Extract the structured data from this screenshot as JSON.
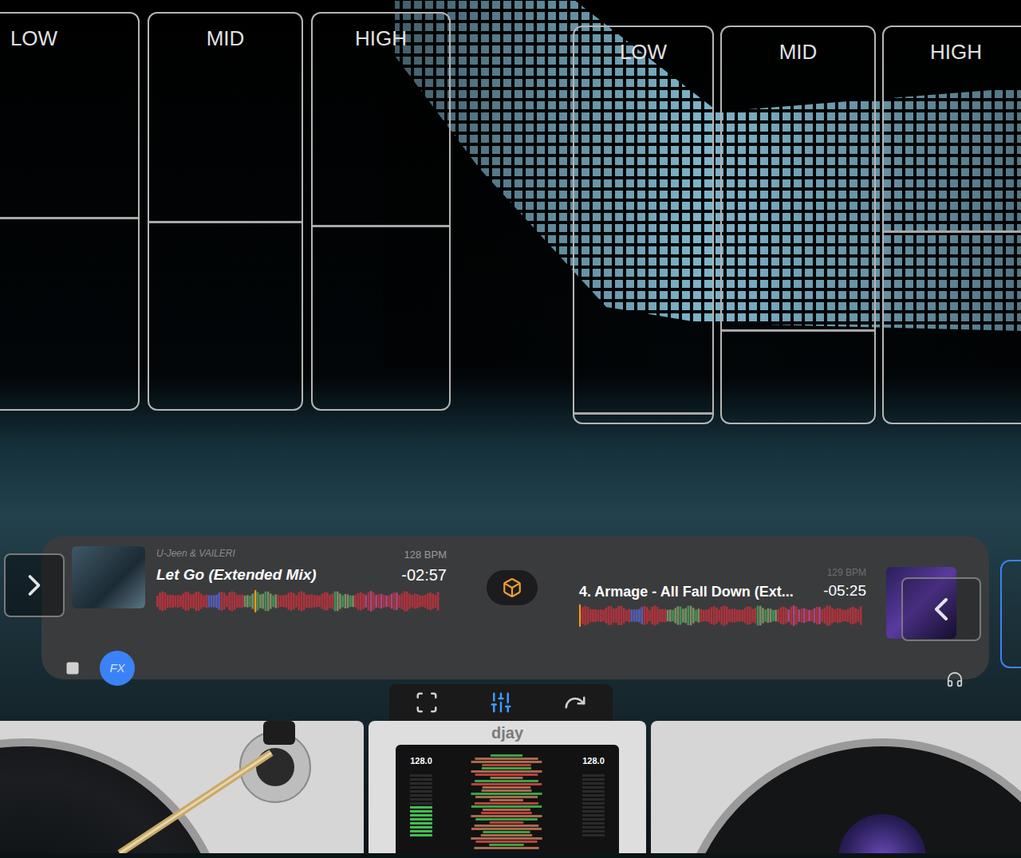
{
  "eq": [
    {
      "deck": "left",
      "bands": [
        {
          "label": "LOW",
          "level": 0.48
        },
        {
          "label": "MID",
          "level": 0.47
        },
        {
          "label": "HIGH",
          "level": 0.46
        }
      ]
    },
    {
      "deck": "right",
      "bands": [
        {
          "label": "LOW",
          "level": 0.02
        },
        {
          "label": "MID",
          "level": 0.23
        },
        {
          "label": "HIGH",
          "level": 0.48
        }
      ]
    }
  ],
  "decks": [
    {
      "side": "left",
      "artist": "U-Jeen & VAILERI",
      "title": "Let Go (Extended Mix)",
      "bpm": "128 BPM",
      "remaining": "-02:57",
      "progress": 0.35
    },
    {
      "side": "right",
      "title": "4. Armage - All Fall Down (Ext...",
      "bpm": "129 BPM",
      "remaining": "-05:25",
      "progress": 0.0
    }
  ],
  "fx_button": {
    "label": "FX",
    "on": true
  },
  "toolbar": [
    {
      "kind": "layout",
      "selected": false
    },
    {
      "kind": "mixer",
      "selected": true
    },
    {
      "kind": "automix",
      "selected": false
    }
  ],
  "mixer": {
    "logo": "djay",
    "channels": [
      {
        "bpm": "128.0",
        "level": 0.45
      },
      {
        "bpm": "128.0",
        "level": 0.0
      }
    ]
  }
}
